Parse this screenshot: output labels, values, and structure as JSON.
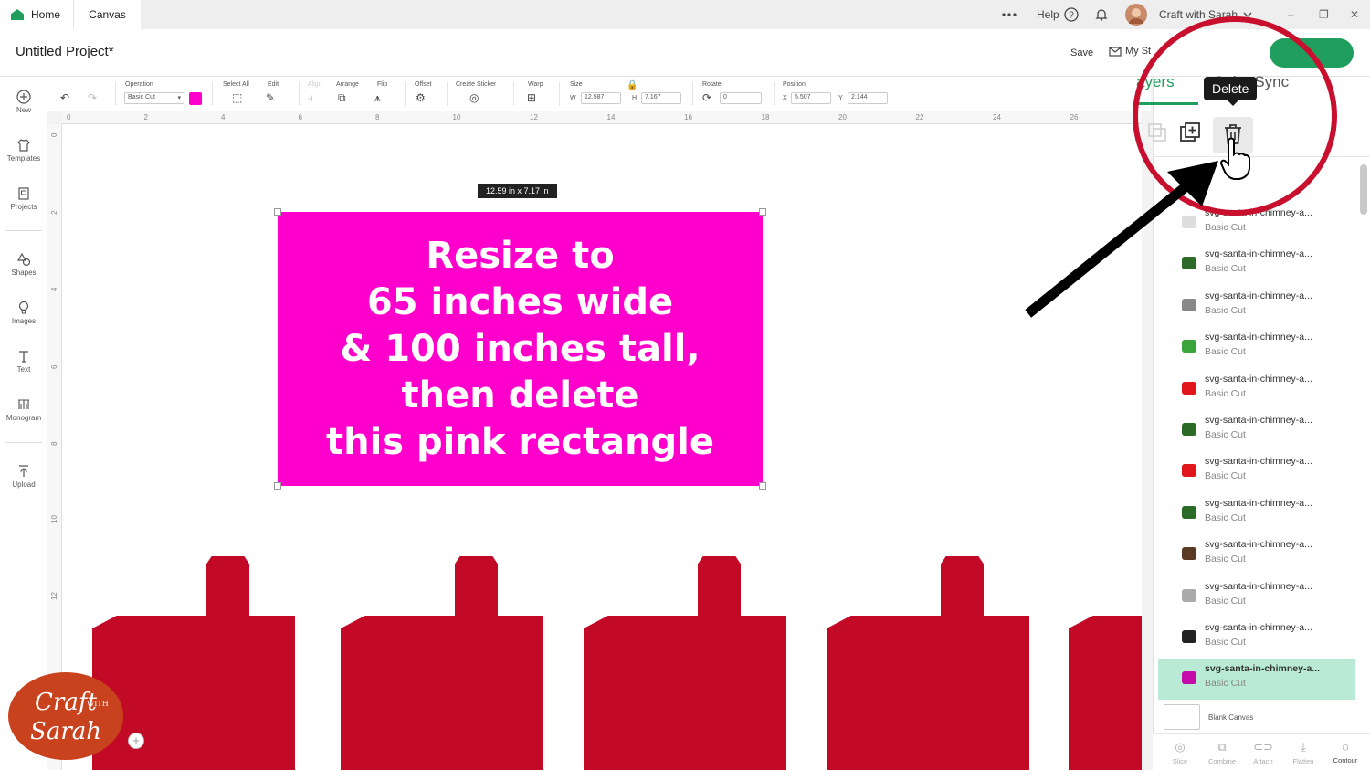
{
  "tabs": {
    "home": "Home",
    "canvas": "Canvas"
  },
  "topright": {
    "help": "Help",
    "user": "Craft with Sarah",
    "minimize": "–",
    "restore": "❐",
    "close": "✕"
  },
  "project": {
    "title": "Untitled Project*",
    "save": "Save",
    "my_stuff": "My St"
  },
  "sidebar": {
    "new": "New",
    "templates": "Templates",
    "projects": "Projects",
    "shapes": "Shapes",
    "images": "Images",
    "text": "Text",
    "monogram": "Monogram",
    "upload": "Upload"
  },
  "toolbar": {
    "operation_label": "Operation",
    "operation_value": "Basic Cut",
    "select_all": "Select All",
    "edit": "Edit",
    "align": "Align",
    "arrange": "Arrange",
    "flip": "Flip",
    "offset": "Offset",
    "create_sticker": "Create Sticker",
    "warp": "Warp",
    "size": "Size",
    "w_label": "W",
    "w_value": "12.587",
    "h_label": "H",
    "h_value": "7.167",
    "rotate": "Rotate",
    "rotate_value": "0",
    "position": "Position",
    "x_label": "X",
    "x_value": "5.507",
    "y_label": "Y",
    "y_value": "2.144"
  },
  "ruler_top": [
    "0",
    "2",
    "4",
    "6",
    "8",
    "10",
    "12",
    "14",
    "16",
    "18",
    "20",
    "22",
    "24",
    "26"
  ],
  "ruler_left": [
    "0",
    "2",
    "4",
    "6",
    "8",
    "10",
    "12"
  ],
  "canvas": {
    "size_tooltip": "12.59  in x 7.17  in",
    "message_lines": [
      "Resize to",
      "65 inches wide",
      "& 100 inches tall,",
      "then delete",
      "this pink rectangle"
    ],
    "rect_color": "#ff00cc",
    "chimney_color": "#c20a26"
  },
  "panel": {
    "tab_layers": "ayers",
    "tab_sync": "Color Sync",
    "delete_tooltip": "Delete",
    "layers": [
      {
        "name": "svg-santa-in-chimney-a...",
        "type": "Basic Cut",
        "color": "#dddddd"
      },
      {
        "name": "svg-santa-in-chimney-a...",
        "type": "Basic Cut",
        "color": "#2e6b2a"
      },
      {
        "name": "svg-santa-in-chimney-a...",
        "type": "Basic Cut",
        "color": "#888888"
      },
      {
        "name": "svg-santa-in-chimney-a...",
        "type": "Basic Cut",
        "color": "#3aa53a"
      },
      {
        "name": "svg-santa-in-chimney-a...",
        "type": "Basic Cut",
        "color": "#e0161b"
      },
      {
        "name": "svg-santa-in-chimney-a...",
        "type": "Basic Cut",
        "color": "#2a6a26"
      },
      {
        "name": "svg-santa-in-chimney-a...",
        "type": "Basic Cut",
        "color": "#e0161b"
      },
      {
        "name": "svg-santa-in-chimney-a...",
        "type": "Basic Cut",
        "color": "#2a6a26"
      },
      {
        "name": "svg-santa-in-chimney-a...",
        "type": "Basic Cut",
        "color": "#5a3a22"
      },
      {
        "name": "svg-santa-in-chimney-a...",
        "type": "Basic Cut",
        "color": "#aaaaaa"
      },
      {
        "name": "svg-santa-in-chimney-a...",
        "type": "Basic Cut",
        "color": "#222222"
      },
      {
        "name": "svg-santa-in-chimney-a...",
        "type": "Basic Cut",
        "color": "#c40aa8",
        "selected": true
      }
    ],
    "blank_canvas": "Blank Canvas",
    "bottom_actions": [
      "Slice",
      "Combine",
      "Attach",
      "Flatten",
      "Contour"
    ]
  },
  "branding": {
    "logo_line1": "Craft",
    "logo_with": "WITH",
    "logo_line2": "Sarah",
    "logo_color": "#c9421e"
  },
  "zoom": {
    "plus": "+"
  }
}
